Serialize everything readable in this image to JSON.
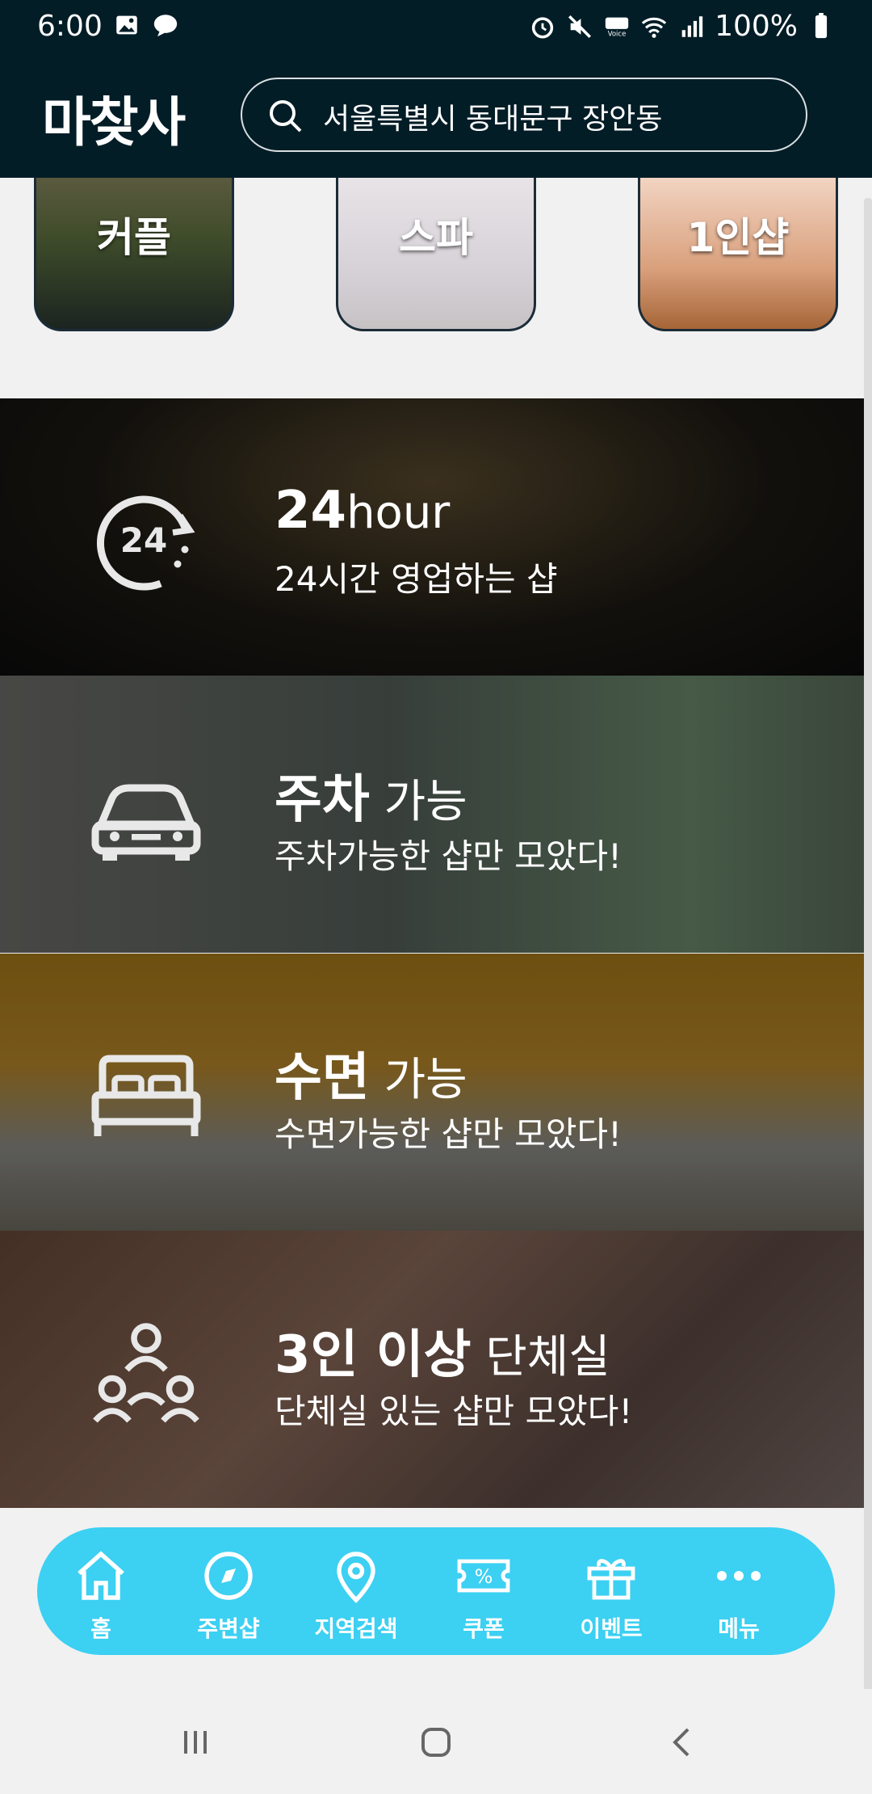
{
  "status_bar": {
    "time": "6:00",
    "battery": "100%"
  },
  "app_bar": {
    "logo": "마찾사",
    "search_text": "서울특별시 동대문구 장안동"
  },
  "categories": [
    {
      "label": "커플"
    },
    {
      "label": "스파"
    },
    {
      "label": "1인샵"
    }
  ],
  "banners": [
    {
      "title_bold": "24",
      "title_light": "hour",
      "subtitle": "24시간 영업하는 샵",
      "icon": "24-hours-icon"
    },
    {
      "title_bold": "주차",
      "title_light": "가능",
      "subtitle": "주차가능한 샵만 모았다!",
      "icon": "car-icon"
    },
    {
      "title_bold": "수면",
      "title_light": "가능",
      "subtitle": "수면가능한 샵만 모았다!",
      "icon": "bed-icon"
    },
    {
      "title_bold": "3인 이상",
      "title_light": "단체실",
      "subtitle": "단체실 있는 샵만 모았다!",
      "icon": "group-icon"
    }
  ],
  "bottom_nav": [
    {
      "label": "홈",
      "icon": "home-icon"
    },
    {
      "label": "주변샵",
      "icon": "compass-icon"
    },
    {
      "label": "지역검색",
      "icon": "location-pin-icon"
    },
    {
      "label": "쿠폰",
      "icon": "coupon-icon"
    },
    {
      "label": "이벤트",
      "icon": "gift-icon"
    },
    {
      "label": "메뉴",
      "icon": "more-icon"
    }
  ],
  "colors": {
    "app_bar_bg": "#031d27",
    "nav_pill": "#3cd0f2",
    "page_bg": "#f1f1f1"
  }
}
